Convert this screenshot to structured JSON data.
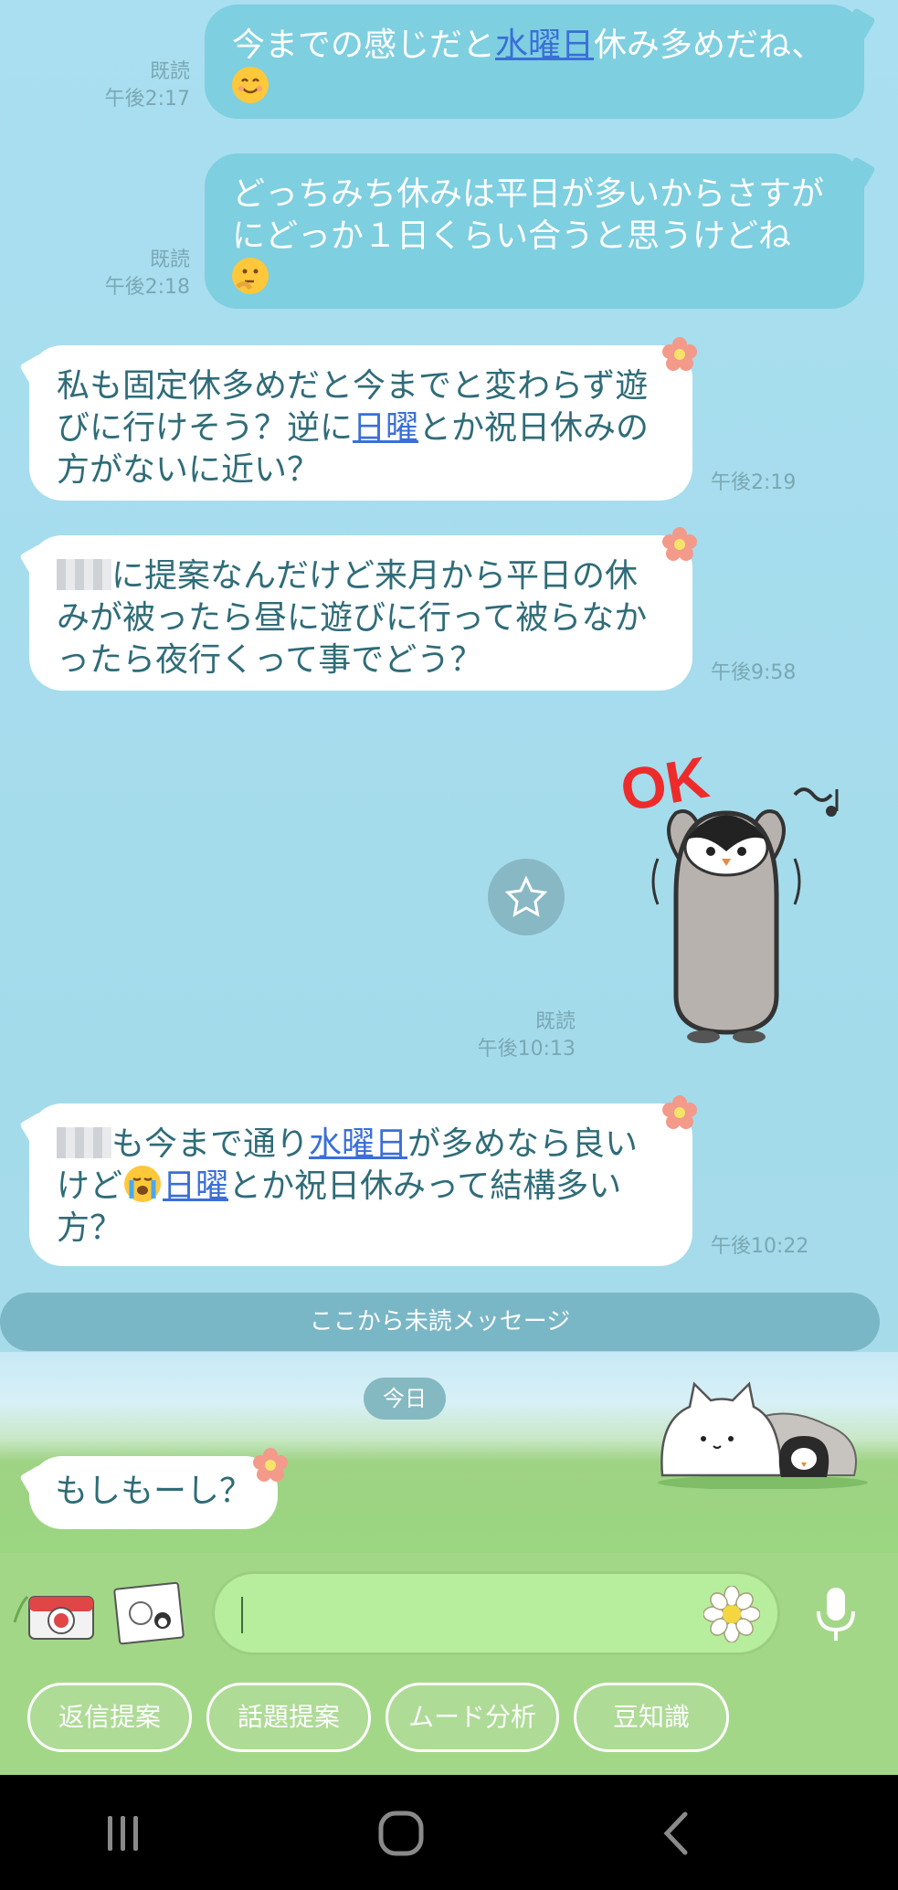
{
  "messages": [
    {
      "id": "m1",
      "type": "sent",
      "segments": [
        {
          "text": "今までの感じだと"
        },
        {
          "text": "水曜日",
          "link": true
        },
        {
          "text": "休み多めだね、"
        }
      ],
      "read": "既読",
      "time": "午後2:17"
    },
    {
      "id": "m2",
      "type": "sent",
      "lines": [
        "どっちみち休みは平日が多いからさすが",
        "にどっか１日くらい合うと思うけどね"
      ],
      "read": "既読",
      "time": "午後2:18"
    },
    {
      "id": "m3",
      "type": "received",
      "line1": "私も固定休多めだと今までと変わらず遊",
      "line2_a": "びに行けそう？逆に",
      "line2_link": "日曜",
      "line2_b": "とか祝日休みの",
      "line3": "方がないに近い？",
      "time": "午後2:19"
    },
    {
      "id": "m4",
      "type": "received",
      "line1": "に提案なんだけど来月から平日の休",
      "line2": "みが被ったら昼に遊びに行って被らなか",
      "line3": "ったら夜行くって事でどう？",
      "time": "午後9:58"
    },
    {
      "id": "m5",
      "type": "sticker",
      "sticker_text": "OK",
      "read": "既読",
      "time": "午後10:13"
    },
    {
      "id": "m6",
      "type": "received",
      "line1_a": "も今まで通り",
      "line1_link": "水曜日",
      "line1_b": "が多めなら良い",
      "line2_a": "けど",
      "line2_link": "日曜",
      "line2_b": "とか祝日休みって結構多い",
      "line3": "方？",
      "time": "午後10:22"
    }
  ],
  "unread_divider": "ここから未読メッセージ",
  "date_chip": "今日",
  "last_message": {
    "text": "もしもーし？"
  },
  "composer": {
    "placeholder": ""
  },
  "suggestions": [
    "返信提案",
    "話題提案",
    "ムード分析",
    "豆知識"
  ],
  "colors": {
    "sent_bubble": "#7ecfe0",
    "received_bubble": "#ffffff",
    "link": "#3a6fd8",
    "background": "#a6dced"
  },
  "icons": [
    "camera-icon",
    "photo-icon",
    "flower-icon",
    "microphone-icon",
    "star-icon",
    "recent-apps-icon",
    "home-icon",
    "back-icon"
  ]
}
